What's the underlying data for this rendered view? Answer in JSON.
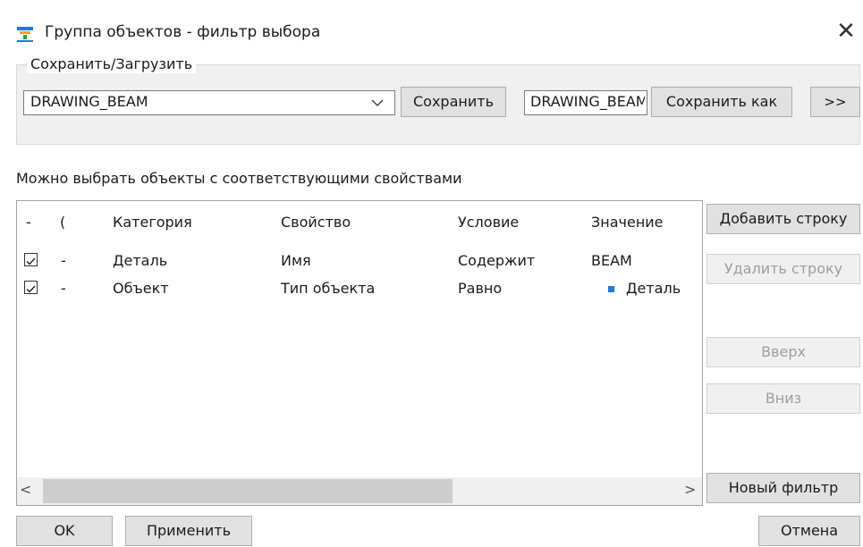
{
  "window": {
    "title": "Группа объектов - фильтр выбора",
    "close_glyph": "✕",
    "icon": "filter-icon"
  },
  "save_load": {
    "legend": "Сохранить/Загрузить",
    "combo_value": "DRAWING_BEAM",
    "save_label": "Сохранить",
    "name_value": "DRAWING_BEAM",
    "save_as_label": "Сохранить как",
    "more_label": ">>"
  },
  "hint": "Можно выбрать объекты с соответствующими свойствами",
  "table": {
    "headers": [
      "-",
      "(",
      "Категория",
      "Свойство",
      "Условие",
      "Значение"
    ],
    "rows": [
      {
        "dash": "-",
        "category": "Деталь",
        "property": "Имя",
        "condition": "Содержит",
        "value": "BEAM",
        "checked": true
      },
      {
        "dash": "-",
        "category": "Объект",
        "property": "Тип объекта",
        "condition": "Равно",
        "value": "Деталь",
        "checked": true
      }
    ],
    "scroll_left": "<",
    "scroll_right": ">"
  },
  "side": {
    "add_row": "Добавить строку",
    "delete_row": "Удалить строку",
    "up": "Вверх",
    "down": "Вниз",
    "new_filter": "Новый фильтр"
  },
  "footer": {
    "ok": "OK",
    "apply": "Применить",
    "cancel": "Отмена"
  },
  "colors": {
    "accent": "#1e7ad6",
    "button_bg": "#e1e1e1",
    "disabled_text": "#9d9d9d"
  }
}
